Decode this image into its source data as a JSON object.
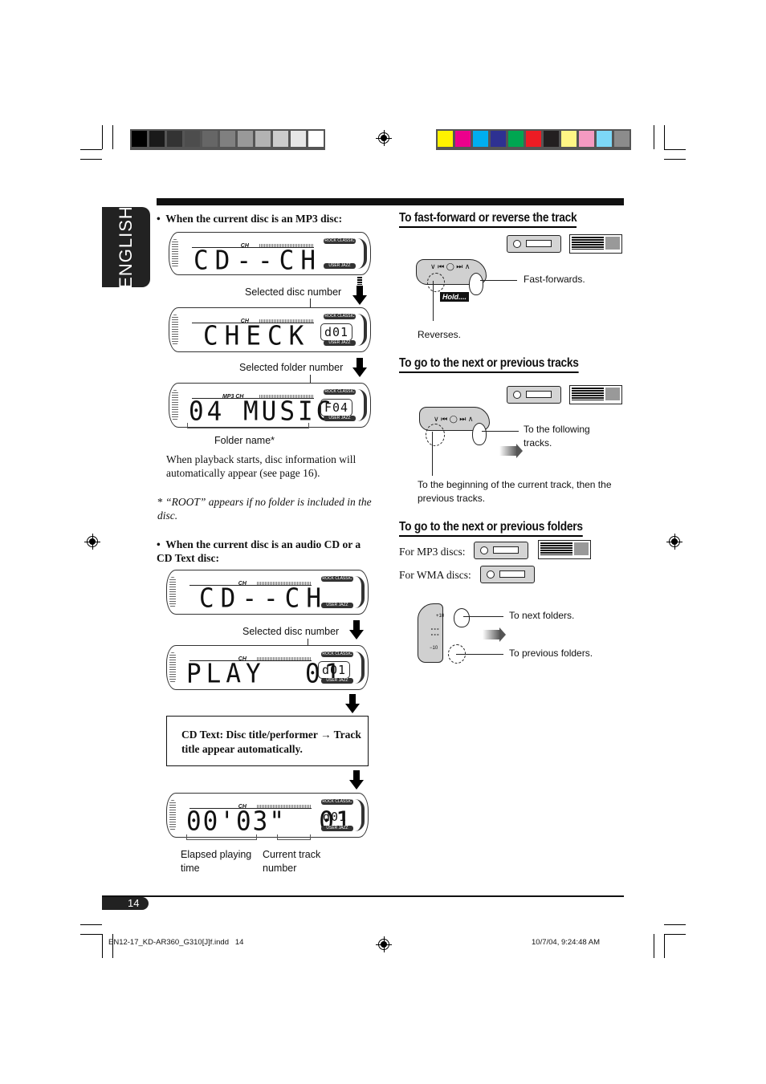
{
  "side_tab": {
    "label": "ENGLISH"
  },
  "color_bars": {
    "grayscale": [
      "#000000",
      "#1a1a1a",
      "#333333",
      "#4d4d4d",
      "#666666",
      "#808080",
      "#999999",
      "#b3b3b3",
      "#cccccc",
      "#e6e6e6",
      "#ffffff"
    ],
    "process": [
      "#fff200",
      "#ec008c",
      "#00aeef",
      "#2e3192",
      "#00a651",
      "#ed1c24",
      "#231f20",
      "#fff685",
      "#f49ac1",
      "#7dd8f7",
      "#8c8c8c"
    ]
  },
  "left": {
    "mp3_bullet": "When the current disc is an MP3 disc:",
    "lcd1": {
      "main": "CD--CH",
      "ch": "CH"
    },
    "label_selected_disc_1": "Selected disc number",
    "lcd2": {
      "main": "CHECK",
      "disc": "d01",
      "ch": "CH"
    },
    "label_selected_folder": "Selected folder number",
    "lcd3": {
      "main": "04 MUSIC",
      "disc": "F04",
      "ch": "MP3 CH"
    },
    "label_folder_name": "Folder name*",
    "playback_note": "When playback starts, disc information will automatically appear (see page 16).",
    "footnote_mark": "*",
    "footnote": "“ROOT” appears if no folder is included in the disc.",
    "cd_bullet": "When the current disc is an audio CD or a CD Text disc:",
    "lcd4": {
      "main": "CD--CH",
      "ch": "CH"
    },
    "label_selected_disc_2": "Selected disc number",
    "lcd5": {
      "main": "PLAY  01",
      "disc": "d01",
      "ch": "CH"
    },
    "cd_text_box": "CD Text: Disc title/performer → Track title appear automatically.",
    "lcd6": {
      "main": "00'03\"  01",
      "disc": "d01",
      "ch": "CH"
    },
    "label_elapsed": "Elapsed playing time",
    "label_track": "Current track number",
    "lcd_pill_top": "ROCK CLASSIC",
    "lcd_pill_bottom": "USER JAZZ"
  },
  "right": {
    "section1": {
      "heading": "To fast-forward or reverse the track",
      "hold": "Hold....",
      "label_ff": "Fast-forwards.",
      "label_rev": "Reverses."
    },
    "section2": {
      "heading": "To go to the next or previous tracks",
      "label_next": "To the following tracks.",
      "label_prev": "To the beginning of the current track, then the previous tracks."
    },
    "section3": {
      "heading": "To go to the next or previous folders",
      "mp3_label": "For MP3 discs:",
      "wma_label": "For WMA discs:",
      "label_next": "To next folders.",
      "label_prev": "To previous folders.",
      "plus10": "+10",
      "minus10": "−10"
    }
  },
  "footer": {
    "page_number": "14",
    "file_name": "EN12-17_KD-AR360_G310[J]f.indd   14",
    "timestamp": "10/7/04, 9:24:48 AM"
  }
}
